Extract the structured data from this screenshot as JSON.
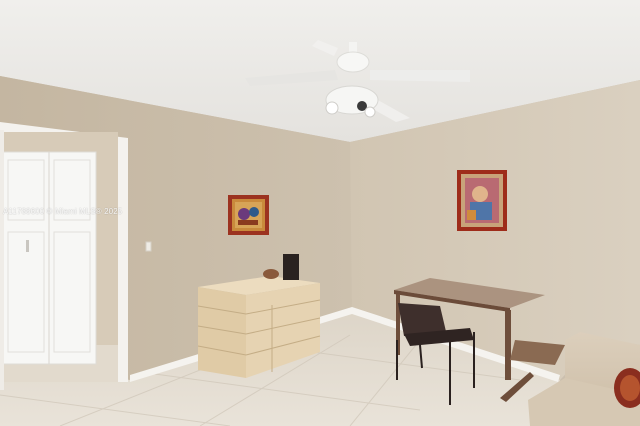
{
  "photo": {
    "watermark": "A11788600 © Miami MLS® 2025",
    "colors": {
      "ceiling": "#ecebe8",
      "wall_left": "#cabda9",
      "wall_right": "#d3c8b6",
      "floor": "#e2dbcf",
      "baseboard": "#f4f2ee",
      "door": "#f6f6f4",
      "dresser": "#e3cfac",
      "desk": "#7b5a44",
      "chair": "#3d2e2b",
      "sofa": "#d9cbb7",
      "frame": "#9c3320"
    }
  }
}
